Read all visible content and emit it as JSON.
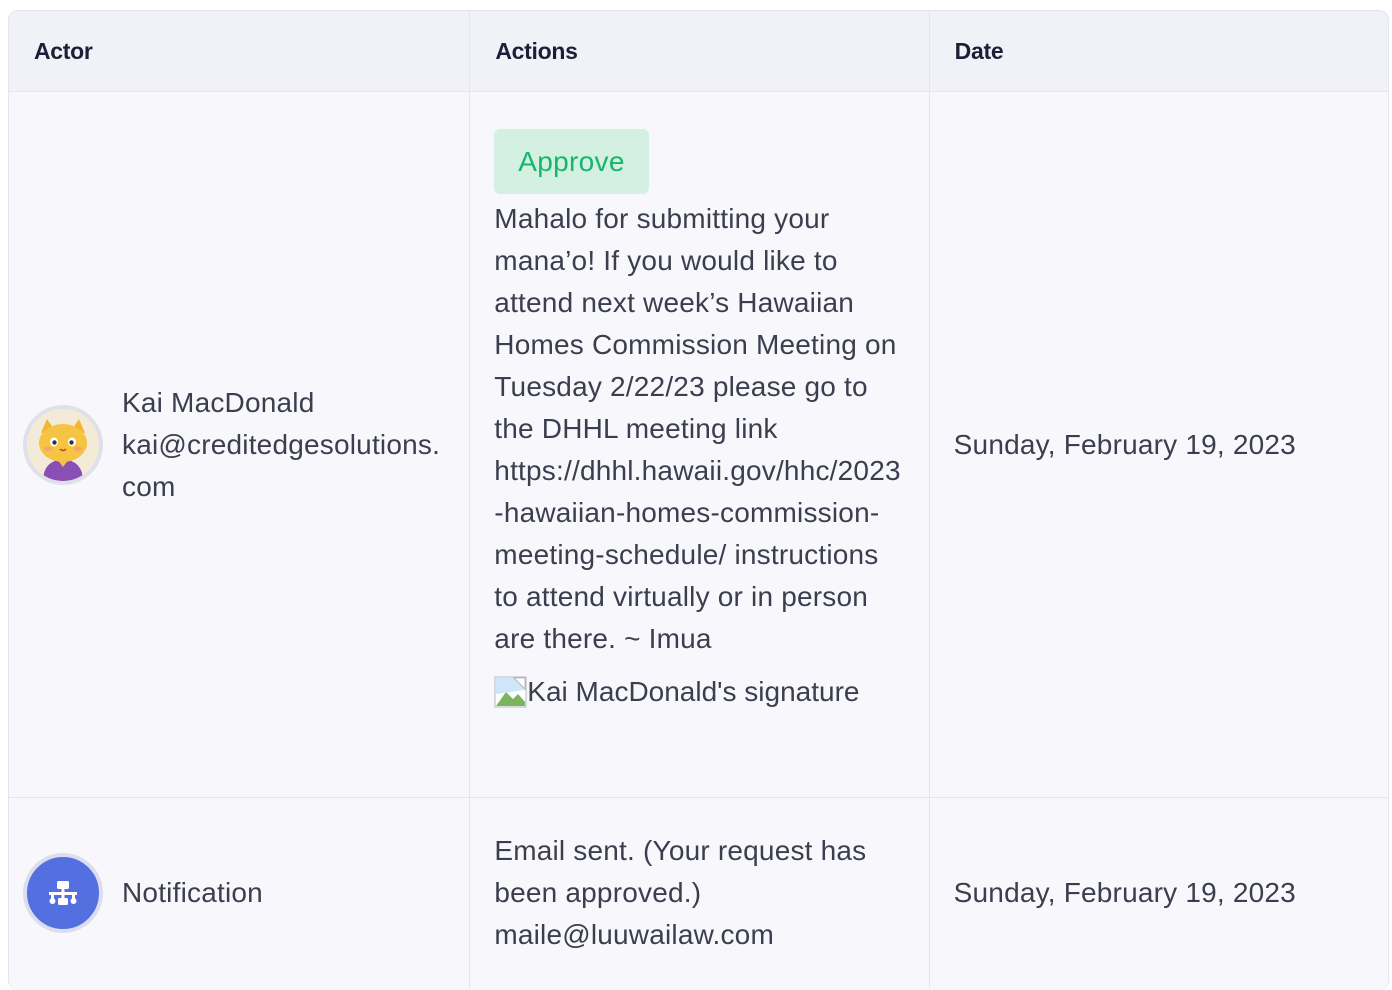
{
  "table": {
    "headers": {
      "actor": "Actor",
      "actions": "Actions",
      "date": "Date"
    },
    "rows": [
      {
        "actor_name": "Kai MacDonald",
        "actor_email": "kai@creditedgesolutions.com",
        "action_label": "Approve",
        "comment": "Mahalo for submitting your mana’o! If you would like to attend next week’s Hawaiian Homes Commission Meeting on Tuesday 2/22/23 please go to the DHHL meeting link https://dhhl.hawaii.gov/hhc/2023-hawaiian-homes-commission-meeting-schedule/ instructions to attend virtually or in person are there. ~ Imua",
        "signature_alt": "Kai MacDonald's signature",
        "date": "Sunday, February 19, 2023",
        "avatar_icon": "cat-avatar-icon"
      },
      {
        "actor_name": "Notification",
        "action_line1": "Email sent. (Your request has been approved.)",
        "action_line2": "maile@luuwailaw.com",
        "date": "Sunday, February 19, 2023",
        "avatar_icon": "workflow-icon"
      }
    ]
  },
  "colors": {
    "approve_bg": "#d3f0e2",
    "approve_text": "#16b66b",
    "notification_avatar": "#5470e0",
    "header_bg": "#f1f2f8"
  }
}
